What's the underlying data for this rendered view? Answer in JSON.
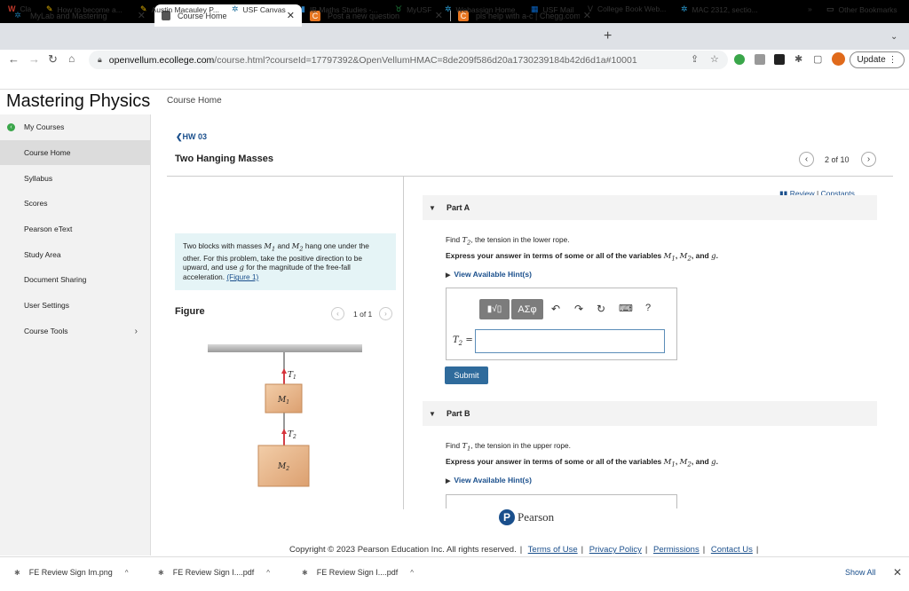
{
  "browser": {
    "tabs": [
      {
        "title": "MyLab and Mastering",
        "favicon": "pearson-icon",
        "active": false
      },
      {
        "title": "Course Home",
        "favicon": "page-icon",
        "active": true
      },
      {
        "title": "Post a new question",
        "favicon": "chegg-icon",
        "active": false
      },
      {
        "title": "pls help with a-c | Chegg.com",
        "favicon": "chegg-icon",
        "active": false
      }
    ],
    "new_tab_symbol": "+",
    "url_host": "openvellum.ecollege.com",
    "url_path": "/course.html?courseId=17797392&OpenVellumHMAC=8de209f586d20a1730239184b42d6d1a#10001",
    "update_label": "Update",
    "bookmarks": [
      "Cla",
      "How to become a...",
      "Austin Macauley P...",
      "USF Canvas",
      "IB Maths Studies -...",
      "MyUSF",
      "Webassign Home",
      "USF Mail",
      "College Book Web...",
      "MAC 2312, sectio..."
    ],
    "bookmarks_more": "»",
    "other_bookmarks": "Other Bookmarks"
  },
  "app": {
    "brand": "Mastering Physics",
    "breadcrumb": "Course Home",
    "sidebar": [
      {
        "label": "My Courses"
      },
      {
        "label": "Course Home"
      },
      {
        "label": "Syllabus"
      },
      {
        "label": "Scores"
      },
      {
        "label": "Pearson eText"
      },
      {
        "label": "Study Area"
      },
      {
        "label": "Document Sharing"
      },
      {
        "label": "User Settings"
      },
      {
        "label": "Course Tools"
      }
    ]
  },
  "assignment": {
    "back_link": "HW 03",
    "title": "Two Hanging Masses",
    "position": "2 of 10",
    "problem_intro": "Two blocks with masses",
    "m1": "M",
    "m1_sub": "1",
    "and_word": "and",
    "m2": "M",
    "m2_sub": "2",
    "problem_mid": "hang one under the other. For this problem, take the positive direction to be upward, and use",
    "g_var": "g",
    "problem_end": "for the magnitude of the free-fall acceleration.",
    "figure_link": "(Figure 1)",
    "figure_label": "Figure",
    "figure_position": "1 of 1",
    "figure_labels": {
      "t1": "T",
      "t1_sub": "1",
      "m1": "M",
      "m1_sub": "1",
      "t2": "T",
      "t2_sub": "2",
      "m2": "M",
      "m2_sub": "2"
    },
    "review": "Review",
    "constants": "Constants",
    "separator": "|"
  },
  "parts": {
    "a": {
      "label": "Part A",
      "find_prefix": "Find",
      "find_var": "T",
      "find_sub": "2",
      "find_suffix": ", the tension in the lower rope.",
      "express": "Express your answer in terms of some or all of the variables",
      "v1": "M",
      "v1_sub": "1",
      "v2": "M",
      "v2_sub": "2",
      "v3": "g",
      "and_word": ", and",
      "comma": ",",
      "period": ".",
      "hint": "View Available Hint(s)",
      "answer_var": "T",
      "answer_sub": "2",
      "answer_eq": " =",
      "answer_value": "",
      "submit": "Submit",
      "toolbar": {
        "greek": "ΑΣφ",
        "help": "?"
      }
    },
    "b": {
      "label": "Part B",
      "find_prefix": "Find",
      "find_var": "T",
      "find_sub": "1",
      "find_suffix": ", the tension in the upper rope.",
      "express": "Express your answer in terms of some or all of the variables",
      "v1": "M",
      "v1_sub": "1",
      "v2": "M",
      "v2_sub": "2",
      "v3": "g",
      "and_word": ", and",
      "comma": ",",
      "period": ".",
      "hint": "View Available Hint(s)"
    }
  },
  "footer": {
    "pearson": "Pearson",
    "copyright": "Copyright © 2023 Pearson Education Inc. All rights reserved.",
    "links": [
      "Terms of Use",
      "Privacy Policy",
      "Permissions",
      "Contact Us"
    ]
  },
  "downloads": {
    "items": [
      "FE Review Sign Im.png",
      "FE Review Sign I....pdf",
      "FE Review Sign I....pdf"
    ],
    "show_all": "Show All"
  },
  "colors": {
    "brand_link": "#1a4f8c",
    "submit": "#2f6b9c",
    "problem_bg": "#e5f4f6",
    "block": "#e8b98a",
    "arrow": "#d6333b"
  }
}
